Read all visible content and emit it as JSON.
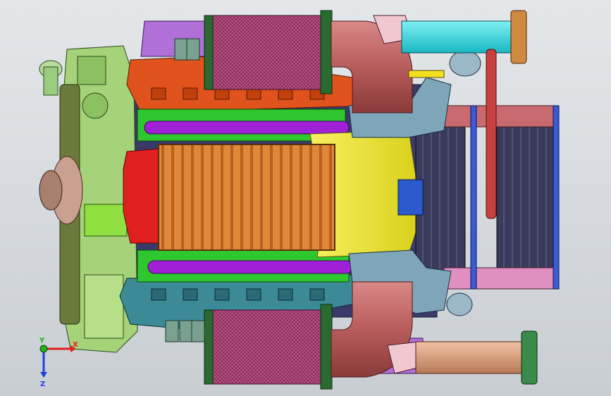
{
  "viewport": {
    "background_top": "#e4e7ea",
    "background_bottom": "#c9ced3"
  },
  "triad": {
    "x_label": "X",
    "y_label": "Y",
    "z_label": "Z",
    "x_color": "#e02020",
    "y_color": "#20b020",
    "z_color": "#2040e0"
  },
  "colors": {
    "intake_pipe": "#b85c5c",
    "air_filter": "#8a2a5a",
    "cyan_pipe": "#22d8e0",
    "copper_pipe": "#d49a78",
    "valve_cover_top": "#e0531c",
    "valve_cover_bottom": "#3c8a96",
    "intercooler": "#e08a3a",
    "manifold": "#f0ea30",
    "front_cover": "#a6d27a",
    "flywheel": "#6a7a3a",
    "purple_rail": "#a020d8",
    "pulley": "#7a8ab8",
    "bracket": "#7fa6b8"
  }
}
